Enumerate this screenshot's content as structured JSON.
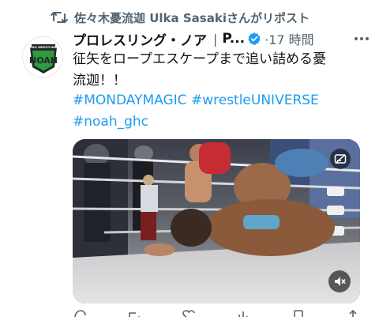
{
  "repost": {
    "text": "佐々木憂流迦 Ulka Sasakiさんがリポスト",
    "icon": "repost-icon"
  },
  "author": {
    "name": "プロレスリング・ノア",
    "separator": "|",
    "name_suffix": "P...",
    "verified_icon": "verified-badge-icon",
    "time": "·17 時間",
    "avatar_icon": "noah-logo",
    "avatar_logo_text": "NOAH",
    "avatar_logo_subtext": "PRO WRESTLING"
  },
  "tweet": {
    "text_line1": "征矢をロープエスケープまで追い詰める憂",
    "text_line2": "流迦！！",
    "hashtags": [
      "#MONDAYMAGIC",
      "#wrestleUNIVERSE",
      "#noah_ghc"
    ]
  },
  "media": {
    "type": "video",
    "top_button_icon": "no-subtitles-icon",
    "mute_icon": "muted-speaker-icon"
  },
  "actions": [
    {
      "icon": "reply-icon",
      "count": ""
    },
    {
      "icon": "repost-icon",
      "count": ""
    },
    {
      "icon": "like-icon",
      "count": ""
    },
    {
      "icon": "views-icon",
      "count": ""
    },
    {
      "icon": "bookmark-icon",
      "count": ""
    },
    {
      "icon": "share-icon",
      "count": ""
    }
  ],
  "colors": {
    "link": "#1d9bf0",
    "muted": "#536471",
    "text": "#0f1419",
    "verified": "#1d9bf0",
    "noah_green": "#2e9b3f"
  }
}
